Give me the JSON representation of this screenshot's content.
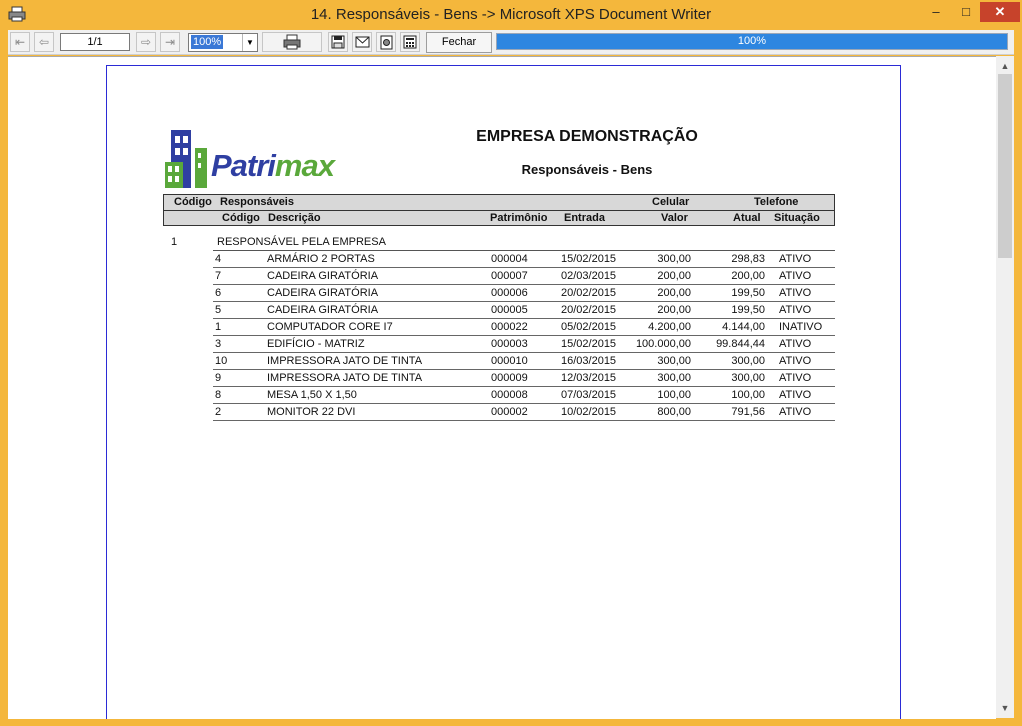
{
  "window": {
    "title": "14. Responsáveis - Bens -> Microsoft XPS Document Writer",
    "minimize_label": "–",
    "maximize_label": "□",
    "close_label": "✕"
  },
  "toolbar": {
    "page_indicator": "1/1",
    "zoom_value": "100%",
    "fechar_label": "Fechar",
    "progress_text": "100%",
    "progress_value": 100,
    "icons": [
      "first-page-icon",
      "prev-page-icon",
      "next-page-icon",
      "last-page-icon",
      "printer-icon",
      "save-icon",
      "email-icon",
      "print-setup-icon",
      "calculator-icon"
    ]
  },
  "report": {
    "logo_text_main": "Patri",
    "logo_text_accent": "max",
    "company": "EMPRESA DEMONSTRAÇÃO",
    "title": "Responsáveis - Bens",
    "headers": {
      "codigo": "Código",
      "responsaveis": "Responsáveis",
      "celular": "Celular",
      "telefone": "Telefone",
      "codigo2": "Código",
      "descricao": "Descrição",
      "patrimonio": "Patrimônio",
      "entrada": "Entrada",
      "valor": "Valor",
      "atual": "Atual",
      "situacao": "Situação"
    },
    "group": {
      "code": "1",
      "name": "RESPONSÁVEL PELA EMPRESA"
    },
    "rows": [
      {
        "codigo": "4",
        "descricao": "ARMÁRIO 2 PORTAS",
        "patrimonio": "000004",
        "entrada": "15/02/2015",
        "valor": "300,00",
        "atual": "298,83",
        "situacao": "ATIVO"
      },
      {
        "codigo": "7",
        "descricao": "CADEIRA GIRATÓRIA",
        "patrimonio": "000007",
        "entrada": "02/03/2015",
        "valor": "200,00",
        "atual": "200,00",
        "situacao": "ATIVO"
      },
      {
        "codigo": "6",
        "descricao": "CADEIRA GIRATÓRIA",
        "patrimonio": "000006",
        "entrada": "20/02/2015",
        "valor": "200,00",
        "atual": "199,50",
        "situacao": "ATIVO"
      },
      {
        "codigo": "5",
        "descricao": "CADEIRA GIRATÓRIA",
        "patrimonio": "000005",
        "entrada": "20/02/2015",
        "valor": "200,00",
        "atual": "199,50",
        "situacao": "ATIVO"
      },
      {
        "codigo": "1",
        "descricao": "COMPUTADOR CORE I7",
        "patrimonio": "000022",
        "entrada": "05/02/2015",
        "valor": "4.200,00",
        "atual": "4.144,00",
        "situacao": "INATIVO"
      },
      {
        "codigo": "3",
        "descricao": "EDIFÍCIO - MATRIZ",
        "patrimonio": "000003",
        "entrada": "15/02/2015",
        "valor": "100.000,00",
        "atual": "99.844,44",
        "situacao": "ATIVO"
      },
      {
        "codigo": "10",
        "descricao": "IMPRESSORA JATO DE TINTA",
        "patrimonio": "000010",
        "entrada": "16/03/2015",
        "valor": "300,00",
        "atual": "300,00",
        "situacao": "ATIVO"
      },
      {
        "codigo": "9",
        "descricao": "IMPRESSORA JATO DE TINTA",
        "patrimonio": "000009",
        "entrada": "12/03/2015",
        "valor": "300,00",
        "atual": "300,00",
        "situacao": "ATIVO"
      },
      {
        "codigo": "8",
        "descricao": "MESA 1,50 X 1,50",
        "patrimonio": "000008",
        "entrada": "07/03/2015",
        "valor": "100,00",
        "atual": "100,00",
        "situacao": "ATIVO"
      },
      {
        "codigo": "2",
        "descricao": "MONITOR 22 DVI",
        "patrimonio": "000002",
        "entrada": "10/02/2015",
        "valor": "800,00",
        "atual": "791,56",
        "situacao": "ATIVO"
      }
    ]
  }
}
